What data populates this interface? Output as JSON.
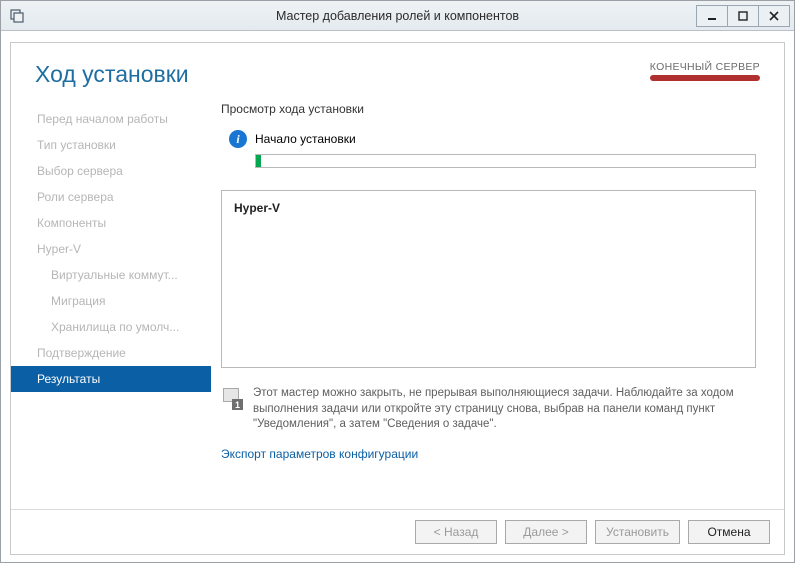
{
  "window": {
    "title": "Мастер добавления ролей и компонентов"
  },
  "header": {
    "heading": "Ход установки",
    "destination_label": "КОНЕЧНЫЙ СЕРВЕР"
  },
  "sidebar": {
    "items": [
      {
        "label": "Перед началом работы",
        "sub": false,
        "active": false
      },
      {
        "label": "Тип установки",
        "sub": false,
        "active": false
      },
      {
        "label": "Выбор сервера",
        "sub": false,
        "active": false
      },
      {
        "label": "Роли сервера",
        "sub": false,
        "active": false
      },
      {
        "label": "Компоненты",
        "sub": false,
        "active": false
      },
      {
        "label": "Hyper-V",
        "sub": false,
        "active": false
      },
      {
        "label": "Виртуальные коммут...",
        "sub": true,
        "active": false
      },
      {
        "label": "Миграция",
        "sub": true,
        "active": false
      },
      {
        "label": "Хранилища по умолч...",
        "sub": true,
        "active": false
      },
      {
        "label": "Подтверждение",
        "sub": false,
        "active": false
      },
      {
        "label": "Результаты",
        "sub": false,
        "active": true
      }
    ]
  },
  "main": {
    "section_label": "Просмотр хода установки",
    "status_text": "Начало установки",
    "progress_percent": 1,
    "detail_role": "Hyper-V",
    "note_text": "Этот мастер можно закрыть, не прерывая выполняющиеся задачи. Наблюдайте за ходом выполнения задачи или откройте эту страницу снова, выбрав на панели команд пункт \"Уведомления\", а затем \"Сведения о задаче\".",
    "export_link": "Экспорт параметров конфигурации"
  },
  "footer": {
    "back": "< Назад",
    "next": "Далее >",
    "install": "Установить",
    "cancel": "Отмена"
  }
}
